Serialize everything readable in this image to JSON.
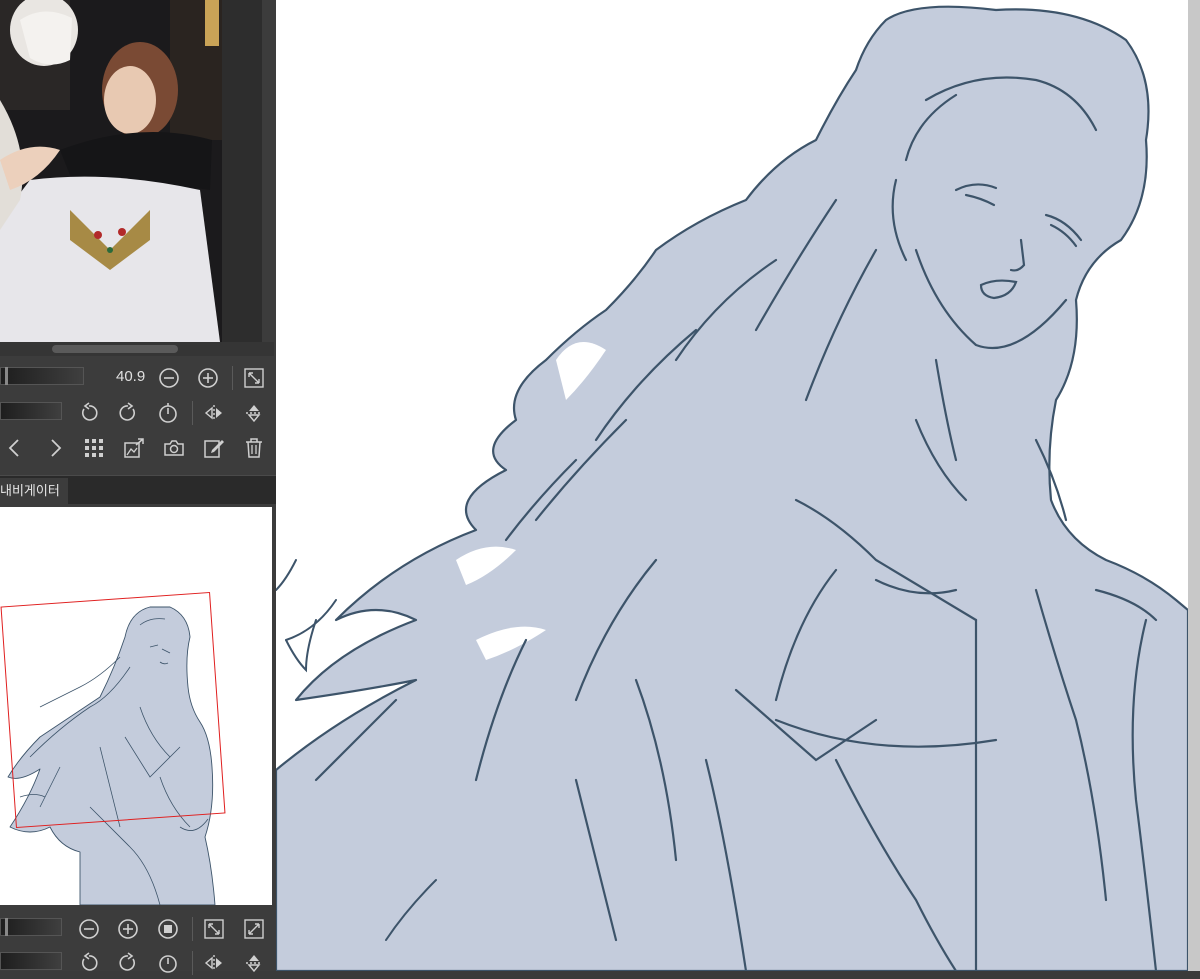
{
  "reference": {
    "photo_description_icon": "reference-photo"
  },
  "ref_toolbar": {
    "zoom_value": "40.9",
    "icons": [
      "zoom-out-icon",
      "zoom-in-icon",
      "fit-icon",
      "rotate-left-icon",
      "rotate-right-icon",
      "reset-rotation-icon",
      "flip-horizontal-icon",
      "flip-vertical-icon",
      "prev-icon",
      "next-icon",
      "grid-icon",
      "import-icon",
      "camera-icon",
      "edit-icon",
      "delete-icon"
    ]
  },
  "navigator": {
    "tab_label": "내비게이터",
    "frame_color": "#e02020"
  },
  "nav_toolbar": {
    "icons": [
      "zoom-out-icon",
      "zoom-in-icon",
      "stop-icon",
      "fit-icon",
      "fill-icon",
      "rotate-left-icon",
      "rotate-right-icon",
      "reset-rotation-icon",
      "flip-horizontal-icon",
      "flip-vertical-icon"
    ]
  },
  "canvas": {
    "fill_color": "#c4ccdc",
    "line_color": "#3d546a",
    "background": "#ffffff"
  }
}
